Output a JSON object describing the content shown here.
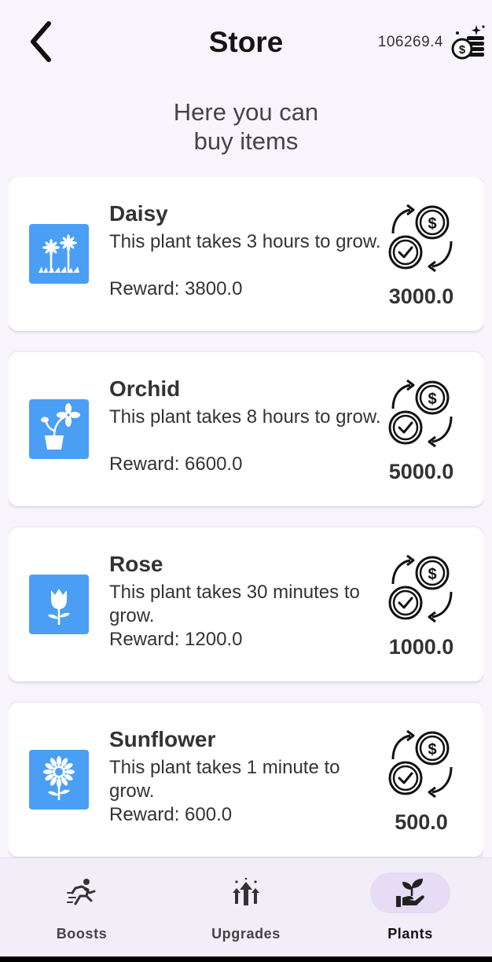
{
  "header": {
    "title": "Store",
    "balance": "106269.4"
  },
  "subtitle": {
    "line1": "Here you can",
    "line2": "buy items"
  },
  "items": [
    {
      "name": "Daisy",
      "description": "This plant takes 3 hours to grow.",
      "reward": "Reward: 3800.0",
      "price": "3000.0",
      "icon": "daisy-icon"
    },
    {
      "name": "Orchid",
      "description": "This plant takes 8 hours to grow.",
      "reward": "Reward: 6600.0",
      "price": "5000.0",
      "icon": "orchid-icon"
    },
    {
      "name": "Rose",
      "description": "This plant takes 30 minutes to grow.",
      "reward": "Reward: 1200.0",
      "price": "1000.0",
      "icon": "rose-icon"
    },
    {
      "name": "Sunflower",
      "description": "This plant takes 1 minute to grow.",
      "reward": "Reward: 600.0",
      "price": "500.0",
      "icon": "sunflower-icon"
    }
  ],
  "nav": {
    "items": [
      {
        "label": "Boosts",
        "icon": "running-person-icon",
        "active": false
      },
      {
        "label": "Upgrades",
        "icon": "upgrade-arrows-icon",
        "active": false
      },
      {
        "label": "Plants",
        "icon": "hand-sprout-icon",
        "active": true
      }
    ]
  },
  "colors": {
    "accent": "#4a9ff5",
    "background": "#f8f4fc",
    "nav_active_pill": "#e6dcf6"
  }
}
